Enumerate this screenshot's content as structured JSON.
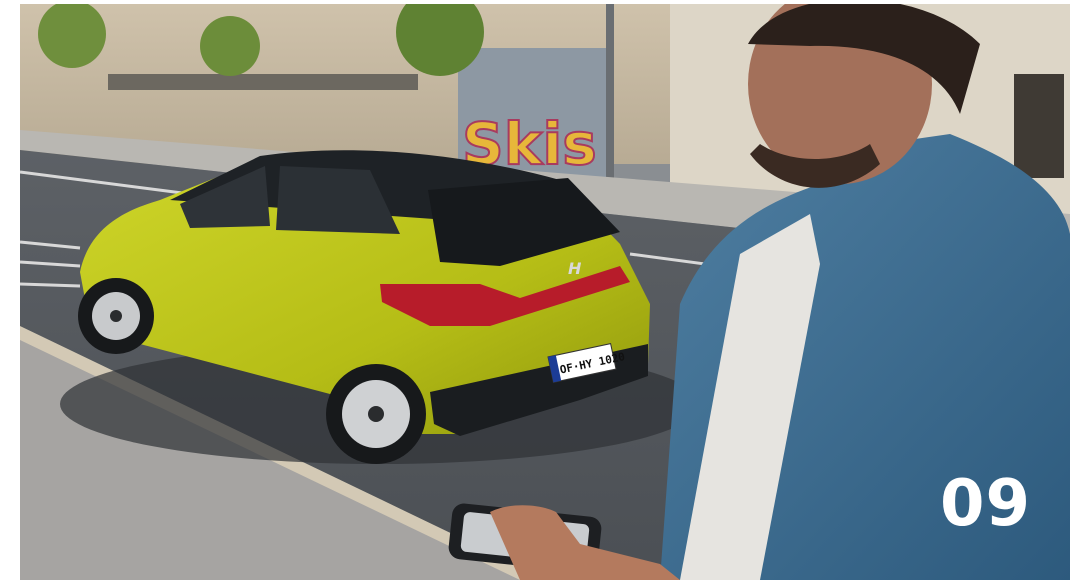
{
  "slide": {
    "number": "09"
  },
  "car": {
    "plate": "OF·HY 1020",
    "color": "#b9c21a"
  },
  "graffiti": {
    "text": "Skis"
  }
}
